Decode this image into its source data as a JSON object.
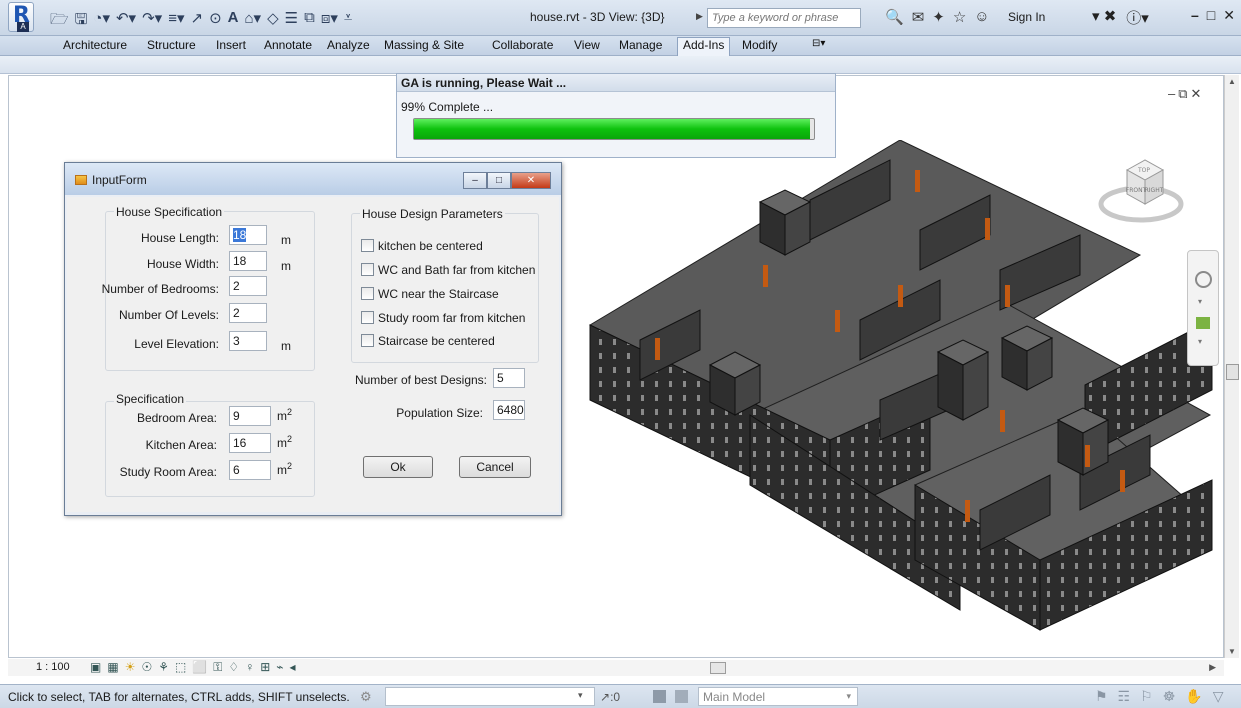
{
  "titlebar": {
    "app_letter": "R",
    "app_sub": "A",
    "doc_title": "house.rvt - 3D View: {3D}",
    "search_placeholder": "Type a keyword or phrase",
    "sign_in": "Sign In"
  },
  "ribbon": {
    "tabs": [
      "Architecture",
      "Structure",
      "Insert",
      "Annotate",
      "Analyze",
      "Massing & Site",
      "Collaborate",
      "View",
      "Manage",
      "Add-Ins",
      "Modify"
    ],
    "active_tab": "Add-Ins"
  },
  "progress": {
    "title": "GA is running, Please Wait ...",
    "status": "99% Complete ...",
    "value": 0.99
  },
  "form": {
    "title": "InputForm",
    "house_spec": {
      "title": "House Specification",
      "house_length_label": "House Length:",
      "house_length": "18",
      "house_length_unit": "m",
      "house_width_label": "House Width:",
      "house_width": "18",
      "house_width_unit": "m",
      "bedrooms_label": "Number of Bedrooms:",
      "bedrooms": "2",
      "levels_label": "Number Of Levels:",
      "levels": "2",
      "level_elev_label": "Level Elevation:",
      "level_elev": "3",
      "level_elev_unit": "m"
    },
    "spec": {
      "title": "Specification",
      "bedroom_area_label": "Bedroom Area:",
      "bedroom_area": "9",
      "kitchen_area_label": "Kitchen Area:",
      "kitchen_area": "16",
      "study_area_label": "Study Room Area:",
      "study_area": "6",
      "area_unit": "m",
      "area_unit_sup": "2"
    },
    "design_params": {
      "title": "House Design Parameters",
      "options": [
        {
          "label": "kitchen be centered",
          "checked": false
        },
        {
          "label": "WC and Bath far from kitchen",
          "checked": false
        },
        {
          "label": "WC near the Staircase",
          "checked": false
        },
        {
          "label": "Study room far from kitchen",
          "checked": false
        },
        {
          "label": "Staircase be centered",
          "checked": false
        }
      ]
    },
    "best_designs_label": "Number of best Designs:",
    "best_designs": "5",
    "population_label": "Population Size:",
    "population": "6480",
    "ok_label": "Ok",
    "cancel_label": "Cancel"
  },
  "viewbar": {
    "scale": "1 : 100"
  },
  "statusbar": {
    "message": "Click to select, TAB for alternates, CTRL adds, SHIFT unselects.",
    "editable_count": ":0",
    "model": "Main Model"
  },
  "viewcube": {
    "face_front": "FRONT",
    "face_right": "RIGHT",
    "face_top": "TOP"
  }
}
